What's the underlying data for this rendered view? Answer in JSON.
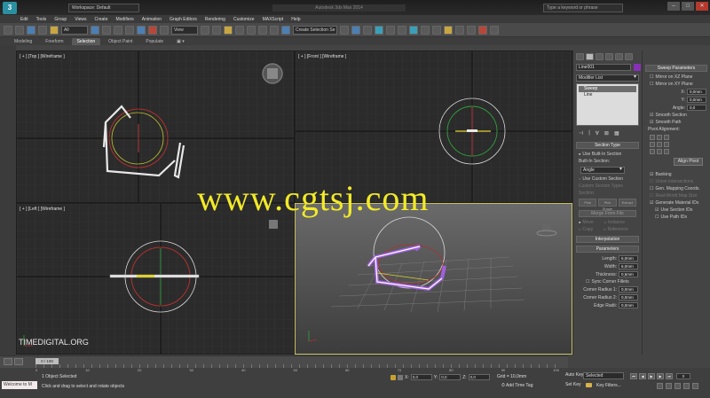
{
  "titlebar": {
    "workspace": "Workspace: Default",
    "title": "Autodesk 3ds Max 2014",
    "search_placeholder": "Type a keyword or phrase"
  },
  "menu": [
    "Edit",
    "Tools",
    "Group",
    "Views",
    "Create",
    "Modifiers",
    "Animation",
    "Graph Editors",
    "Rendering",
    "Customize",
    "MAXScript",
    "Help"
  ],
  "toolbar": {
    "filter_value": "All",
    "view_value": "View",
    "selection_set": "Create Selection Se"
  },
  "ribbon": {
    "tabs": [
      "Modeling",
      "Freeform",
      "Selection",
      "Object Paint",
      "Populate"
    ],
    "active_index": 2
  },
  "viewports": {
    "top": "[ + ] [Top ] [Wireframe ]",
    "front": "[ + ] [Front ] [Wireframe ]",
    "left": "[ + ] [Left ] [Wireframe ]",
    "perspective": ""
  },
  "watermark": "www.cgtsj.com",
  "brand": "TIMEDIGITAL.ORG",
  "command_panel": {
    "object_name": "Line001",
    "object_color": "#8830b8",
    "modifier_list": "Modifier List",
    "stack": [
      "Sweep",
      "Line"
    ],
    "section_type": {
      "title": "Section Type",
      "use_builtin": "Use Built-In Section",
      "builtin_label": "Built-In Section:",
      "builtin_value": "Angle",
      "use_custom": "Use Custom Section",
      "custom_types": "Custom Section Types",
      "section_label": "Section:",
      "pick": "Pick",
      "pick_shape": "Pick Shape",
      "extract": "Extract",
      "merge": "Merge From File",
      "move": "Move",
      "instance": "Instance",
      "copy": "Copy",
      "reference": "Reference"
    },
    "interpolation": "Interpolation",
    "parameters": {
      "title": "Parameters",
      "fields": [
        {
          "label": "Length:",
          "value": "6,0mm"
        },
        {
          "label": "Width:",
          "value": "6,0mm"
        },
        {
          "label": "Thickness:",
          "value": "0,5mm"
        }
      ],
      "sync_corner": "Sync Corner Fillets",
      "corner_fields": [
        {
          "label": "Corner Radius 1:",
          "value": "0,0mm"
        },
        {
          "label": "Corner Radius 2:",
          "value": "0,0mm"
        },
        {
          "label": "Edge Radii:",
          "value": "0,0mm"
        }
      ]
    }
  },
  "sweep_params": {
    "title": "Sweep Parameters",
    "mirror_xz": "Mirror on XZ Plane",
    "mirror_xy": "Mirror on XY Plane",
    "x_label": "X:",
    "x_value": "0,0mm",
    "y_label": "Y:",
    "y_value": "0,0mm",
    "angle_label": "Angle:",
    "angle_value": "0,0",
    "smooth_section": "Smooth Section",
    "smooth_path": "Smooth Path",
    "pivot_alignment": "Pivot Alignment:",
    "align_pivot": "Align Pivot",
    "banking": "Banking",
    "union_intersections": "Union Intersections",
    "gen_mapping": "Gen. Mapping Coords.",
    "real_world": "Real-World Map Size",
    "gen_material": "Generate Material IDs",
    "use_section_ids": "Use Section IDs",
    "use_path_ids": "Use Path IDs"
  },
  "timeline": {
    "slider": "0 / 100",
    "ticks": [
      "0",
      "10",
      "20",
      "30",
      "40",
      "50",
      "60",
      "70",
      "80",
      "90",
      "100"
    ]
  },
  "status": {
    "maxscript": "Welcome to M",
    "line1": "1 Object Selected",
    "line2": "Click and drag to select and rotate objects",
    "x_label": "X:",
    "x_value": "0,0",
    "y_label": "Y:",
    "y_value": "0,0",
    "z_label": "Z:",
    "z_value": "0,0",
    "grid": "Grid = 10,0mm",
    "add_time_tag": "Add Time Tag",
    "auto_key": "Auto Key",
    "set_key": "Set Key",
    "selected": "Selected",
    "key_filters": "Key Filters...",
    "frame": "0"
  }
}
